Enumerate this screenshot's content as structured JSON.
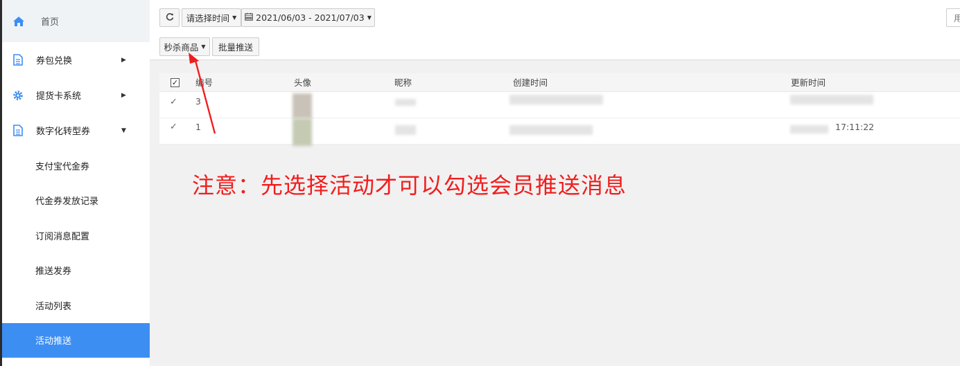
{
  "sidebar": {
    "home": {
      "label": "首页",
      "icon": "home-icon"
    },
    "groups": [
      {
        "label": "券包兑换",
        "icon": "document-icon",
        "expanded": false
      },
      {
        "label": "提货卡系统",
        "icon": "gear-icon",
        "expanded": false
      },
      {
        "label": "数字化转型券",
        "icon": "document-icon",
        "expanded": true
      }
    ],
    "sub_items": [
      {
        "label": "支付宝代金券",
        "active": false
      },
      {
        "label": "代金券发放记录",
        "active": false
      },
      {
        "label": "订阅消息配置",
        "active": false
      },
      {
        "label": "推送发券",
        "active": false
      },
      {
        "label": "活动列表",
        "active": false
      },
      {
        "label": "活动推送",
        "active": true
      }
    ]
  },
  "toolbar": {
    "refresh_icon": "refresh-icon",
    "time_select_label": "请选择时间",
    "calendar_icon": "calendar-icon",
    "date_range": "2021/06/03 - 2021/07/03",
    "right_partial": "用",
    "activity_select_label": "秒杀商品",
    "batch_push_label": "批量推送"
  },
  "table": {
    "headers": [
      "编号",
      "头像",
      "昵称",
      "创建时间",
      "更新时间"
    ],
    "rows": [
      {
        "id": "3",
        "checked": true,
        "update_time": ""
      },
      {
        "id": "1",
        "checked": true,
        "update_time": "17:11:22"
      }
    ]
  },
  "annotation": {
    "notice": "注意：先选择活动才可以勾选会员推送消息",
    "color": "#f11d1d"
  },
  "colors": {
    "accent": "#3d8ef3",
    "notice_red": "#f11d1d"
  }
}
